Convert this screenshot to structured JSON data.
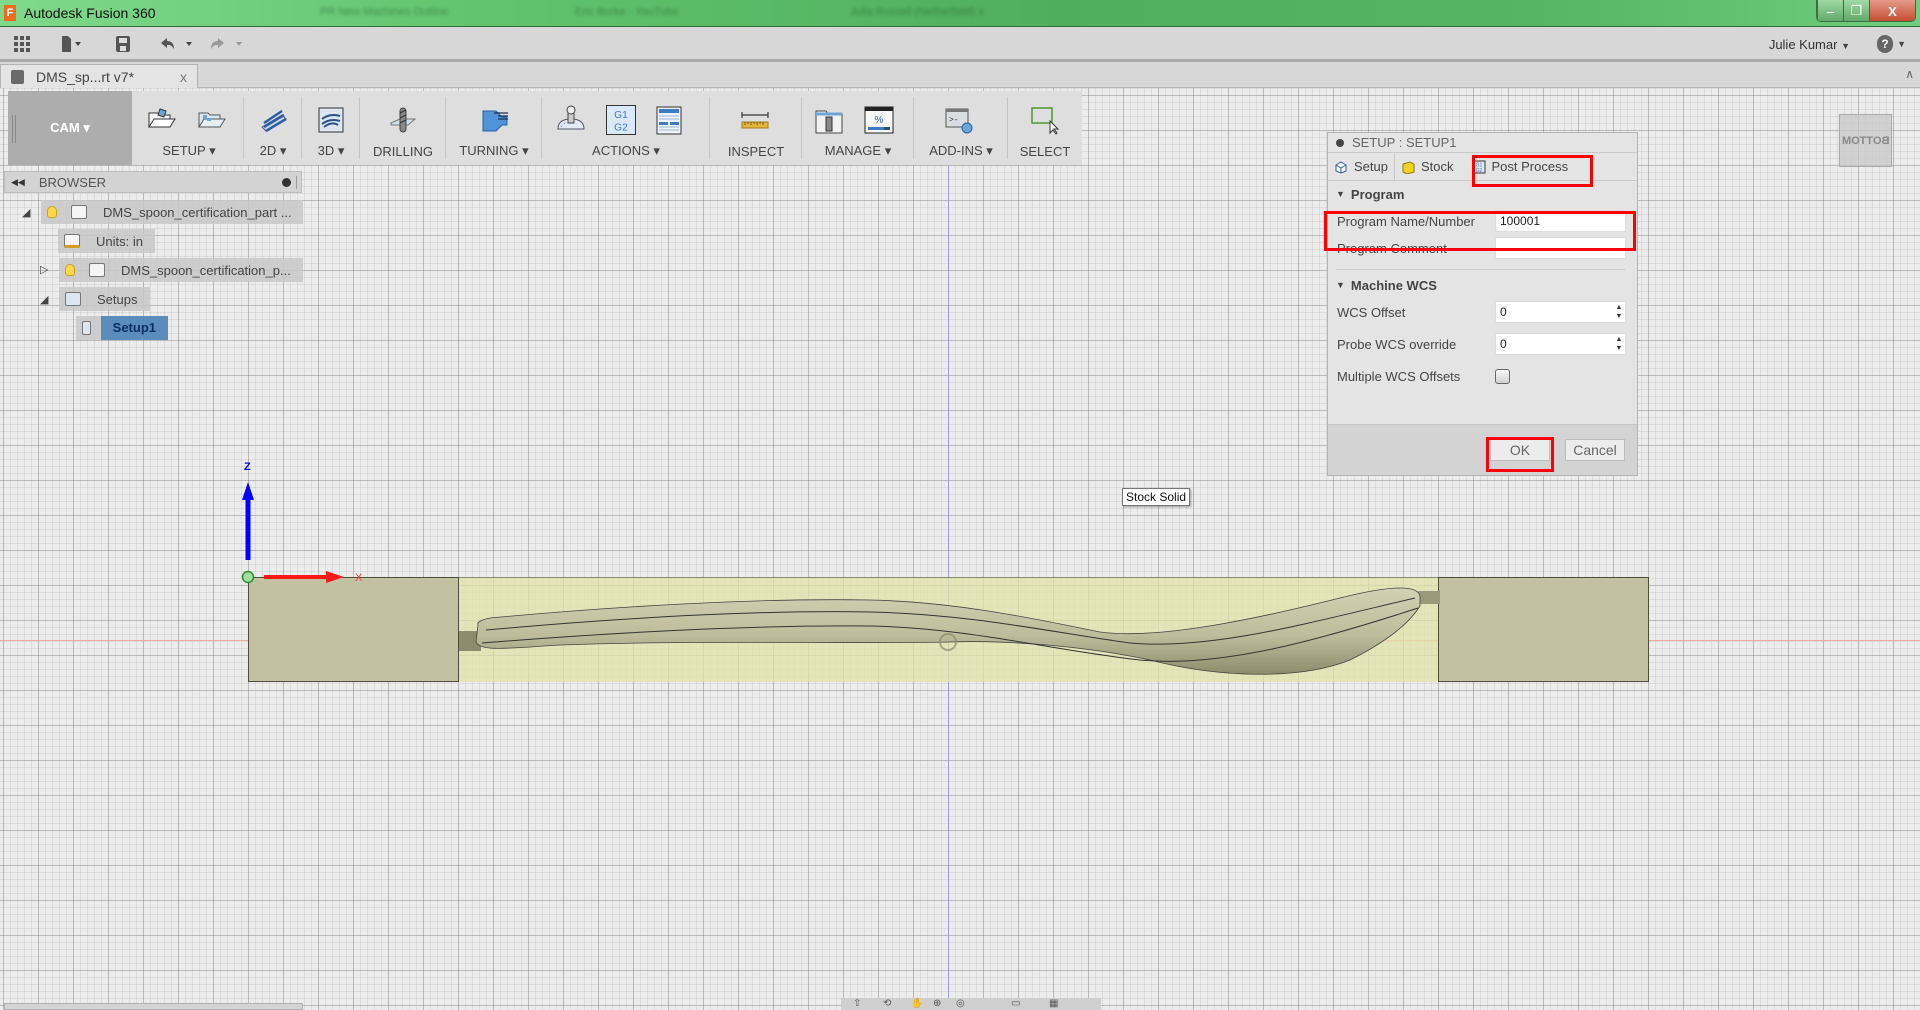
{
  "window": {
    "title": "Autodesk Fusion 360",
    "background_tabs": [
      "PR New Machines Outline",
      "Eric Burke - YouTube",
      "Julia Russell (Netherfield) x"
    ],
    "controls": {
      "minimize": "–",
      "restore": "❐",
      "close": "X"
    }
  },
  "quick_access": {
    "user_name": "Julie Kumar",
    "help_label": "?",
    "icons": [
      "apps-grid-icon",
      "file-icon",
      "save-icon",
      "undo-icon",
      "redo-icon"
    ]
  },
  "document_tab": {
    "name": "DMS_sp...rt v7*",
    "close": "x"
  },
  "toolbar": {
    "workspace": "CAM ▾",
    "groups": [
      {
        "label": "SETUP ▾"
      },
      {
        "label": "2D ▾"
      },
      {
        "label": "3D ▾"
      },
      {
        "label": "DRILLING"
      },
      {
        "label": "TURNING ▾"
      },
      {
        "label": "ACTIONS ▾"
      },
      {
        "label": "INSPECT"
      },
      {
        "label": "MANAGE ▾"
      },
      {
        "label": "ADD-INS ▾"
      },
      {
        "label": "SELECT"
      }
    ],
    "g1g2_text": "G1\nG2",
    "percent_text": "%"
  },
  "browser": {
    "title": "BROWSER",
    "nodes": [
      {
        "label": "DMS_spoon_certification_part ..."
      },
      {
        "label": "Units: in"
      },
      {
        "label": "DMS_spoon_certification_p..."
      },
      {
        "label": "Setups"
      },
      {
        "label": "Setup1",
        "selected": true
      }
    ]
  },
  "dialog": {
    "title": "SETUP : SETUP1",
    "tabs": [
      {
        "label": "Setup"
      },
      {
        "label": "Stock"
      },
      {
        "label": "Post Process",
        "active": true
      }
    ],
    "sections": {
      "program": {
        "title": "Program",
        "program_name_label": "Program Name/Number",
        "program_name_value": "100001",
        "program_comment_label": "Program Comment",
        "program_comment_value": ""
      },
      "machine_wcs": {
        "title": "Machine WCS",
        "wcs_offset_label": "WCS Offset",
        "wcs_offset_value": "0",
        "probe_wcs_label": "Probe WCS override",
        "probe_wcs_value": "0",
        "multiple_wcs_label": "Multiple WCS Offsets",
        "multiple_wcs_checked": false
      }
    },
    "ok_label": "OK",
    "cancel_label": "Cancel",
    "highlight_color": "#ff0000"
  },
  "viewport": {
    "tooltip": "Stock Solid",
    "viewcube_face": "BOTTOM",
    "axis_z_label": "Z",
    "axis_x_label": "X",
    "colors": {
      "stock": "#c2c2a2",
      "stock_transparent": "#e2e2a8",
      "z_axis": "#0000ff",
      "x_axis": "#ff0000"
    }
  }
}
